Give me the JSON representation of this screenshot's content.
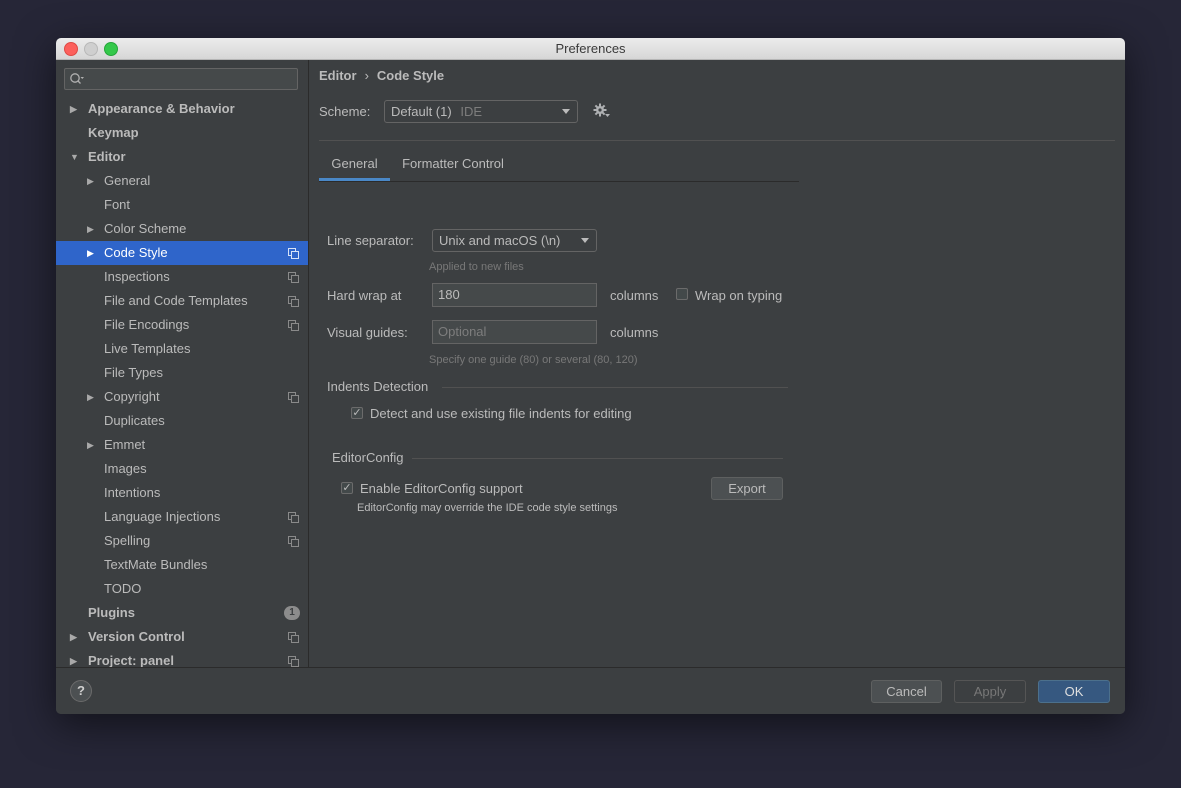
{
  "window": {
    "title": "Preferences"
  },
  "sidebar": {
    "search_placeholder": "",
    "items": [
      {
        "label": "Appearance & Behavior"
      },
      {
        "label": "Keymap"
      },
      {
        "label": "Editor"
      },
      {
        "label": "General"
      },
      {
        "label": "Font"
      },
      {
        "label": "Color Scheme"
      },
      {
        "label": "Code Style"
      },
      {
        "label": "Inspections"
      },
      {
        "label": "File and Code Templates"
      },
      {
        "label": "File Encodings"
      },
      {
        "label": "Live Templates"
      },
      {
        "label": "File Types"
      },
      {
        "label": "Copyright"
      },
      {
        "label": "Duplicates"
      },
      {
        "label": "Emmet"
      },
      {
        "label": "Images"
      },
      {
        "label": "Intentions"
      },
      {
        "label": "Language Injections"
      },
      {
        "label": "Spelling"
      },
      {
        "label": "TextMate Bundles"
      },
      {
        "label": "TODO"
      },
      {
        "label": "Plugins",
        "badge": "1"
      },
      {
        "label": "Version Control"
      },
      {
        "label": "Project: panel"
      }
    ],
    "selected_color": "#2f65ca"
  },
  "breadcrumb": {
    "parent": "Editor",
    "separator": "›",
    "current": "Code Style"
  },
  "scheme": {
    "label": "Scheme:",
    "value": "Default (1)",
    "qualifier": "IDE"
  },
  "tabs": [
    {
      "label": "General"
    },
    {
      "label": "Formatter Control"
    }
  ],
  "general": {
    "line_separator": {
      "label": "Line separator:",
      "value": "Unix and macOS (\\n)",
      "hint": "Applied to new files"
    },
    "hard_wrap": {
      "label": "Hard wrap at",
      "value": "180",
      "unit": "columns"
    },
    "wrap_on_typing": {
      "label": "Wrap on typing",
      "checked": false
    },
    "visual_guides": {
      "label": "Visual guides:",
      "placeholder": "Optional",
      "unit": "columns",
      "hint": "Specify one guide (80) or several (80, 120)"
    },
    "indents": {
      "title": "Indents Detection",
      "detect_label": "Detect and use existing file indents for editing",
      "detect_checked": true,
      "check_mark": "✓"
    },
    "editorconfig": {
      "title": "EditorConfig",
      "enable_label": "Enable EditorConfig support",
      "enable_checked": true,
      "check_mark": "✓",
      "export_label": "Export",
      "note": "EditorConfig may override the IDE code style settings"
    }
  },
  "footer": {
    "help_label": "?",
    "cancel_label": "Cancel",
    "apply_label": "Apply",
    "ok_label": "OK",
    "accent": "#365880"
  }
}
